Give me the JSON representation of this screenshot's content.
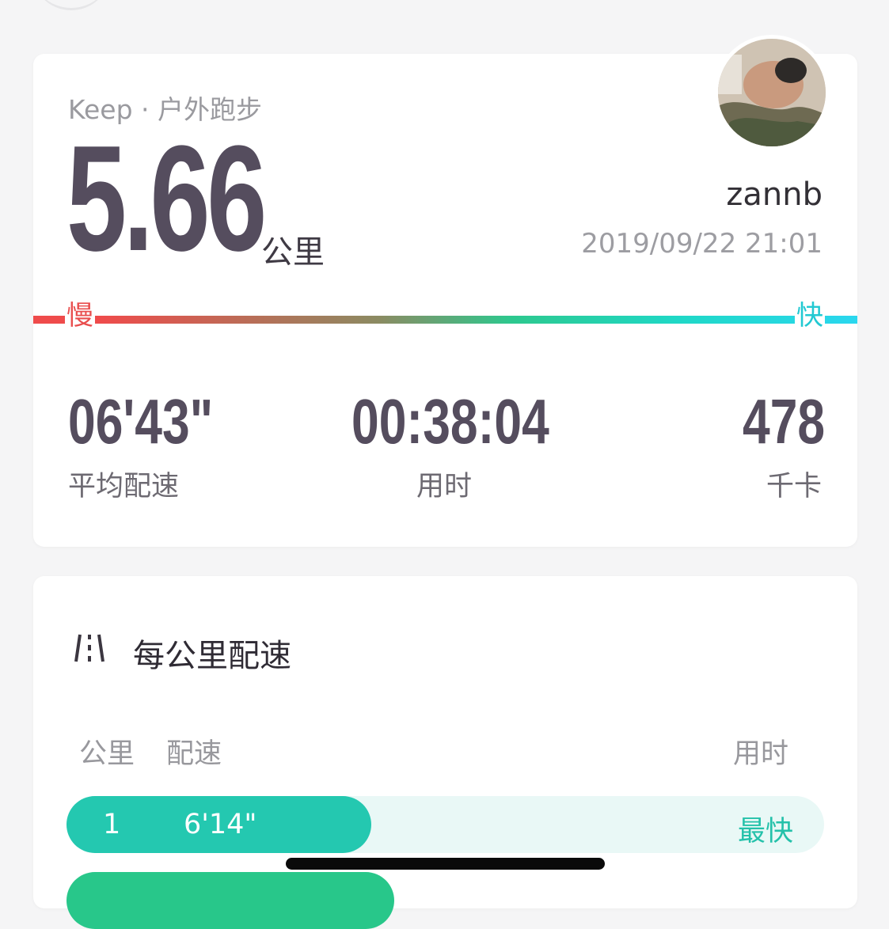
{
  "summary": {
    "app_label": "Keep · 户外跑步",
    "distance": "5.66",
    "distance_unit": "公里",
    "username": "zannb",
    "datetime": "2019/09/22 21:01",
    "pace_scale": {
      "slow": "慢",
      "fast": "快"
    },
    "stats": [
      {
        "value": "06'43\"",
        "label": "平均配速"
      },
      {
        "value": "00:38:04",
        "label": "用时"
      },
      {
        "value": "478",
        "label": "千卡"
      }
    ]
  },
  "splits": {
    "title": "每公里配速",
    "icon": "pace-splits-icon",
    "headers": {
      "km": "公里",
      "pace": "配速",
      "time": "用时"
    },
    "rows": [
      {
        "km": "1",
        "pace": "6'14\"",
        "badge": "最快",
        "relative_speed": 0.42
      }
    ]
  },
  "colors": {
    "primary_text": "#554d5e",
    "slow": "#ef4b4b",
    "fast": "#2ad7ef",
    "split_fast": "#24c8b0",
    "split_track": "#e9f8f6"
  }
}
